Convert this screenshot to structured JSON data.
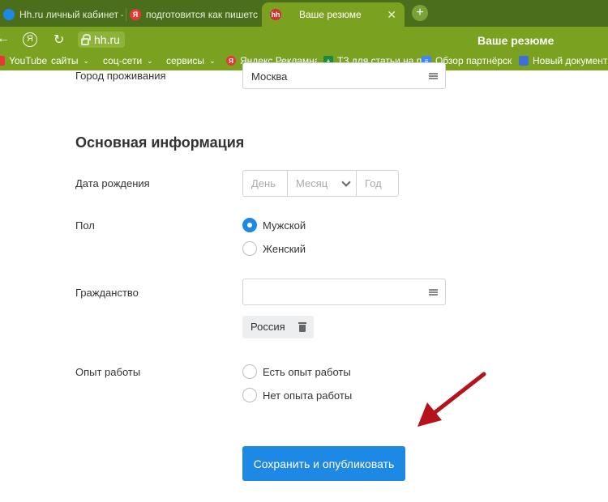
{
  "browser": {
    "tabs": [
      {
        "label": "Hh.ru личный кабинет – д",
        "favicon_color": "#1e88e5",
        "active": false
      },
      {
        "label": "подготовится как пишетс",
        "favicon_color": "#e53935",
        "favicon_glyph": "Я",
        "active": false
      },
      {
        "label": "Ваше резюме",
        "favicon_color": "#d32f2f",
        "favicon_glyph": "hh",
        "active": true
      }
    ],
    "new_tab_glyph": "+",
    "close_glyph": "✕",
    "back_glyph": "←",
    "yandex_glyph": "Я",
    "reload_glyph": "↻",
    "url": "hh.ru",
    "page_title": "Ваше резюме",
    "bookmarks": [
      {
        "label": "YouTube",
        "icon_color": "#e53935"
      },
      {
        "label": "сайты",
        "folder": true
      },
      {
        "label": "соц-сети",
        "folder": true
      },
      {
        "label": "сервисы",
        "folder": true
      },
      {
        "label": "Яндекс Рекламная",
        "icon_color": "#e53935",
        "icon_glyph": "Я"
      },
      {
        "label": "ТЗ для статьи на п",
        "icon_color": "#1b8a3a",
        "icon_glyph": "+"
      },
      {
        "label": "Обзор партнёрски",
        "icon_color": "#4285f4",
        "icon_glyph": "≡"
      },
      {
        "label": "Новый документ",
        "icon_color": "#3d6fd6",
        "icon_glyph": ""
      }
    ],
    "chevron_glyph": "⌄"
  },
  "form": {
    "city": {
      "label": "Город проживания",
      "value": "Москва"
    },
    "section_title": "Основная информация",
    "birth_date": {
      "label": "Дата рождения",
      "day_placeholder": "День",
      "month_placeholder": "Месяц",
      "year_placeholder": "Год"
    },
    "gender": {
      "label": "Пол",
      "options": [
        {
          "label": "Мужской",
          "checked": true
        },
        {
          "label": "Женский",
          "checked": false
        }
      ]
    },
    "citizenship": {
      "label": "Гражданство",
      "value": "",
      "chip": "Россия"
    },
    "experience": {
      "label": "Опыт работы",
      "options": [
        {
          "label": "Есть опыт работы",
          "checked": false
        },
        {
          "label": "Нет опыта работы",
          "checked": false
        }
      ]
    },
    "save_button": "Сохранить и опубликовать"
  },
  "colors": {
    "accent": "#1e88e5",
    "annotation_arrow": "#b5121b"
  }
}
